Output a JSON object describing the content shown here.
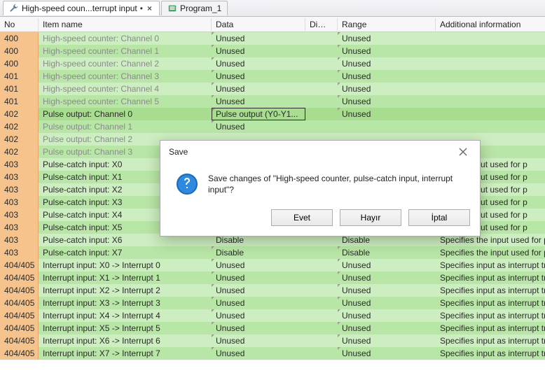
{
  "tabs": [
    {
      "label": "High-speed coun...terrupt input",
      "dirty": "•",
      "icon": "wrench-icon",
      "close": "×",
      "active": true
    },
    {
      "label": "Program_1",
      "dirty": "",
      "icon": "module-icon",
      "close": "",
      "active": false
    }
  ],
  "columns": {
    "no": "No",
    "item": "Item name",
    "data": "Data",
    "dime": "Dime...",
    "range": "Range",
    "addl": "Additional information"
  },
  "rows": [
    {
      "no": "400",
      "item": "High-speed counter: Channel 0",
      "data": "Unused",
      "dime": "",
      "range": "Unused",
      "addl": "",
      "muted": true,
      "hl": false
    },
    {
      "no": "400",
      "item": "High-speed counter: Channel 1",
      "data": "Unused",
      "dime": "",
      "range": "Unused",
      "addl": "",
      "muted": true,
      "hl": false
    },
    {
      "no": "400",
      "item": "High-speed counter: Channel 2",
      "data": "Unused",
      "dime": "",
      "range": "Unused",
      "addl": "",
      "muted": true,
      "hl": false
    },
    {
      "no": "401",
      "item": "High-speed counter: Channel 3",
      "data": "Unused",
      "dime": "",
      "range": "Unused",
      "addl": "",
      "muted": true,
      "hl": false
    },
    {
      "no": "401",
      "item": "High-speed counter: Channel 4",
      "data": "Unused",
      "dime": "",
      "range": "Unused",
      "addl": "",
      "muted": true,
      "hl": false
    },
    {
      "no": "401",
      "item": "High-speed counter: Channel 5",
      "data": "Unused",
      "dime": "",
      "range": "Unused",
      "addl": "",
      "muted": true,
      "hl": false
    },
    {
      "no": "402",
      "item": "Pulse output: Channel 0",
      "data": "Pulse output (Y0-Y1...",
      "dime": "",
      "range": "Unused",
      "addl": "",
      "muted": false,
      "hl": true
    },
    {
      "no": "402",
      "item": "Pulse output: Channel 1",
      "data": "Unused",
      "dime": "",
      "range": "",
      "addl": "",
      "muted": true,
      "hl": false
    },
    {
      "no": "402",
      "item": "Pulse output: Channel 2",
      "data": "",
      "dime": "",
      "range": "",
      "addl": "",
      "muted": true,
      "hl": false
    },
    {
      "no": "402",
      "item": "Pulse output: Channel 3",
      "data": "",
      "dime": "",
      "range": "",
      "addl": "",
      "muted": true,
      "hl": false
    },
    {
      "no": "403",
      "item": "Pulse-catch input: X0",
      "data": "",
      "dime": "",
      "range": "",
      "addl": "fies the input used for p",
      "muted": false,
      "hl": false
    },
    {
      "no": "403",
      "item": "Pulse-catch input: X1",
      "data": "",
      "dime": "",
      "range": "",
      "addl": "fies the input used for p",
      "muted": false,
      "hl": false
    },
    {
      "no": "403",
      "item": "Pulse-catch input: X2",
      "data": "",
      "dime": "",
      "range": "",
      "addl": "fies the input used for p",
      "muted": false,
      "hl": false
    },
    {
      "no": "403",
      "item": "Pulse-catch input: X3",
      "data": "",
      "dime": "",
      "range": "",
      "addl": "fies the input used for p",
      "muted": false,
      "hl": false
    },
    {
      "no": "403",
      "item": "Pulse-catch input: X4",
      "data": "",
      "dime": "",
      "range": "",
      "addl": "fies the input used for p",
      "muted": false,
      "hl": false
    },
    {
      "no": "403",
      "item": "Pulse-catch input: X5",
      "data": "",
      "dime": "",
      "range": "",
      "addl": "fies the input used for p",
      "muted": false,
      "hl": false
    },
    {
      "no": "403",
      "item": "Pulse-catch input: X6",
      "data": "Disable",
      "dime": "",
      "range": "Disable",
      "addl": "Specifies the input used for p",
      "muted": false,
      "hl": false
    },
    {
      "no": "403",
      "item": "Pulse-catch input: X7",
      "data": "Disable",
      "dime": "",
      "range": "Disable",
      "addl": "Specifies the input used for p",
      "muted": false,
      "hl": false
    },
    {
      "no": "404/405",
      "item": "Interrupt input: X0 -> Interrupt 0",
      "data": "Unused",
      "dime": "",
      "range": "Unused",
      "addl": "Specifies input as interrupt tr",
      "muted": false,
      "hl": false
    },
    {
      "no": "404/405",
      "item": "Interrupt input: X1 -> Interrupt 1",
      "data": "Unused",
      "dime": "",
      "range": "Unused",
      "addl": "Specifies input as interrupt tr",
      "muted": false,
      "hl": false
    },
    {
      "no": "404/405",
      "item": "Interrupt input: X2 -> Interrupt 2",
      "data": "Unused",
      "dime": "",
      "range": "Unused",
      "addl": "Specifies input as interrupt tr",
      "muted": false,
      "hl": false
    },
    {
      "no": "404/405",
      "item": "Interrupt input: X3 -> Interrupt 3",
      "data": "Unused",
      "dime": "",
      "range": "Unused",
      "addl": "Specifies input as interrupt tr",
      "muted": false,
      "hl": false
    },
    {
      "no": "404/405",
      "item": "Interrupt input: X4 -> Interrupt 4",
      "data": "Unused",
      "dime": "",
      "range": "Unused",
      "addl": "Specifies input as interrupt tr",
      "muted": false,
      "hl": false
    },
    {
      "no": "404/405",
      "item": "Interrupt input: X5 -> Interrupt 5",
      "data": "Unused",
      "dime": "",
      "range": "Unused",
      "addl": "Specifies input as interrupt tr",
      "muted": false,
      "hl": false
    },
    {
      "no": "404/405",
      "item": "Interrupt input: X6 -> Interrupt 6",
      "data": "Unused",
      "dime": "",
      "range": "Unused",
      "addl": "Specifies input as interrupt tr",
      "muted": false,
      "hl": false
    },
    {
      "no": "404/405",
      "item": "Interrupt input: X7 -> Interrupt 7",
      "data": "Unused",
      "dime": "",
      "range": "Unused",
      "addl": "Specifies input as interrupt tr",
      "muted": false,
      "hl": false
    }
  ],
  "dialog": {
    "title": "Save",
    "message": "Save changes of \"High-speed counter, pulse-catch input, interrupt input\"?",
    "buttons": {
      "yes": "Evet",
      "no": "Hayır",
      "cancel": "İptal"
    }
  }
}
